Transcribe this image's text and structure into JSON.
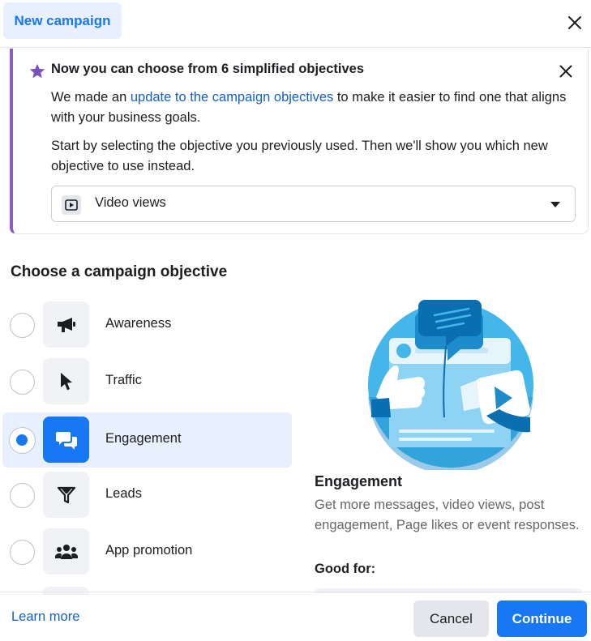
{
  "header": {
    "tab_label": "New campaign",
    "close_icon": "close-icon"
  },
  "notice": {
    "title": "Now you can choose from 6 simplified objectives",
    "body1_prefix": "We made an ",
    "body1_link": "update to the campaign objectives",
    "body1_suffix": " to make it easier to find one that aligns with your business goals.",
    "body2": "Start by selecting the objective you previously used. Then we'll show you which new objective to use instead.",
    "select_value": "Video views",
    "star_icon": "star-icon",
    "accent_color": "#8d5cc9"
  },
  "section_title": "Choose a campaign objective",
  "objectives": [
    {
      "label": "Awareness",
      "icon": "megaphone-icon",
      "selected": false
    },
    {
      "label": "Traffic",
      "icon": "cursor-icon",
      "selected": false
    },
    {
      "label": "Engagement",
      "icon": "chat-bubbles-icon",
      "selected": true
    },
    {
      "label": "Leads",
      "icon": "funnel-icon",
      "selected": false
    },
    {
      "label": "App promotion",
      "icon": "people-icon",
      "selected": false
    }
  ],
  "detail": {
    "title": "Engagement",
    "description": "Get more messages, video views, post engagement, Page likes or event responses.",
    "good_for_label": "Good for:"
  },
  "footer": {
    "learn_more": "Learn more",
    "cancel": "Cancel",
    "continue": "Continue"
  },
  "colors": {
    "primary": "#1877f2",
    "link": "#1460c2",
    "selected_bg": "#e7f0fc"
  }
}
